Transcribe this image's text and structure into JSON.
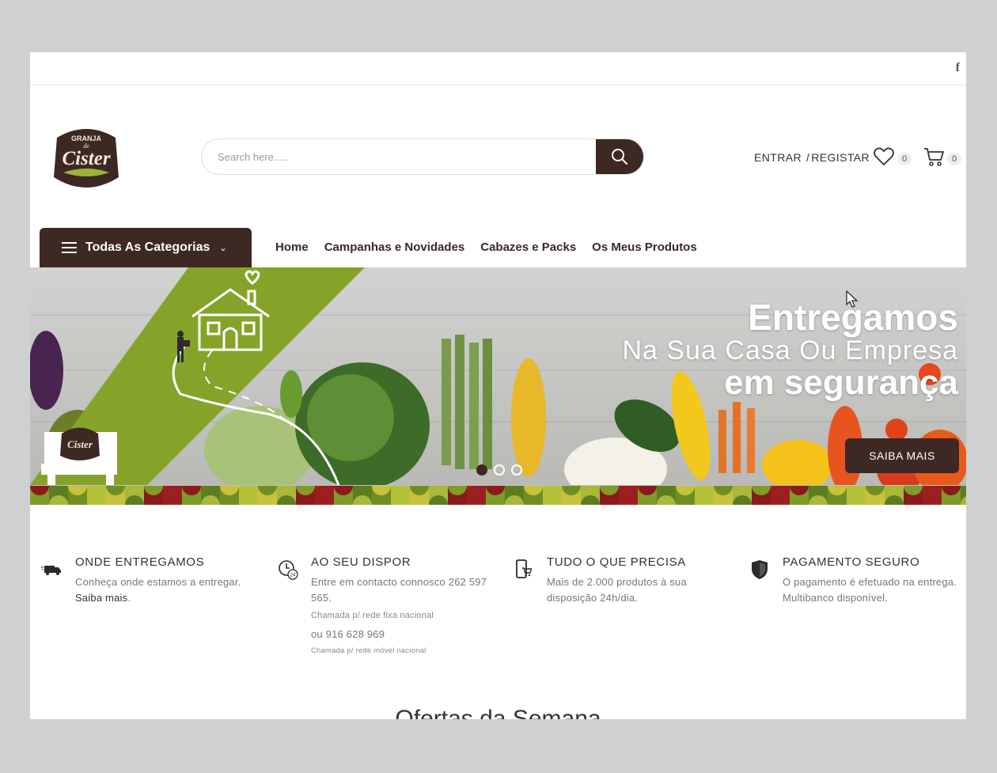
{
  "topbar": {
    "facebook_label": "f"
  },
  "header": {
    "logo_text": {
      "top": "GRANJA",
      "mid": "de",
      "main": "Cister"
    },
    "search_placeholder": "Search here.....",
    "account": {
      "login": "ENTRAR",
      "sep": " /",
      "register": "REGISTAR"
    },
    "wishlist_count": "0",
    "cart_count": "0"
  },
  "nav": {
    "categories_label": "Todas As Categorias",
    "menu": [
      "Home",
      "Campanhas e Novidades",
      "Cabazes e Packs",
      "Os Meus Produtos"
    ]
  },
  "banner": {
    "line1": "Entregamos",
    "line2": "Na Sua Casa Ou Empresa",
    "line3": "em segurança",
    "cta": "SAIBA MAIS",
    "slides": 3,
    "active_slide": 0
  },
  "features": [
    {
      "title": "ONDE ENTREGAMOS",
      "desc": "Conheça onde estamos a entregar.",
      "link": "Saiba mais",
      "icon": "truck-icon"
    },
    {
      "title": "AO SEU DISPOR",
      "desc": "Entre em contacto connosco 262 597 565.",
      "note1": "Chamada p/ rede fixa nacional",
      "phone2": "ou 916 628 969",
      "note2": "Chamada p/ rede móvel nacional",
      "icon": "clock-24-icon"
    },
    {
      "title": "TUDO O QUE PRECISA",
      "desc": "Mais de 2.000 produtos à sua disposição 24h/dia.",
      "icon": "mobile-cart-icon"
    },
    {
      "title": "PAGAMENTO SEGURO",
      "desc": "O pagamento é efetuado na entrega. Multibanco disponível.",
      "icon": "shield-icon"
    }
  ],
  "offers_title": "Ofertas da Semana",
  "colors": {
    "brand": "#3d2824",
    "green": "#86a329"
  }
}
